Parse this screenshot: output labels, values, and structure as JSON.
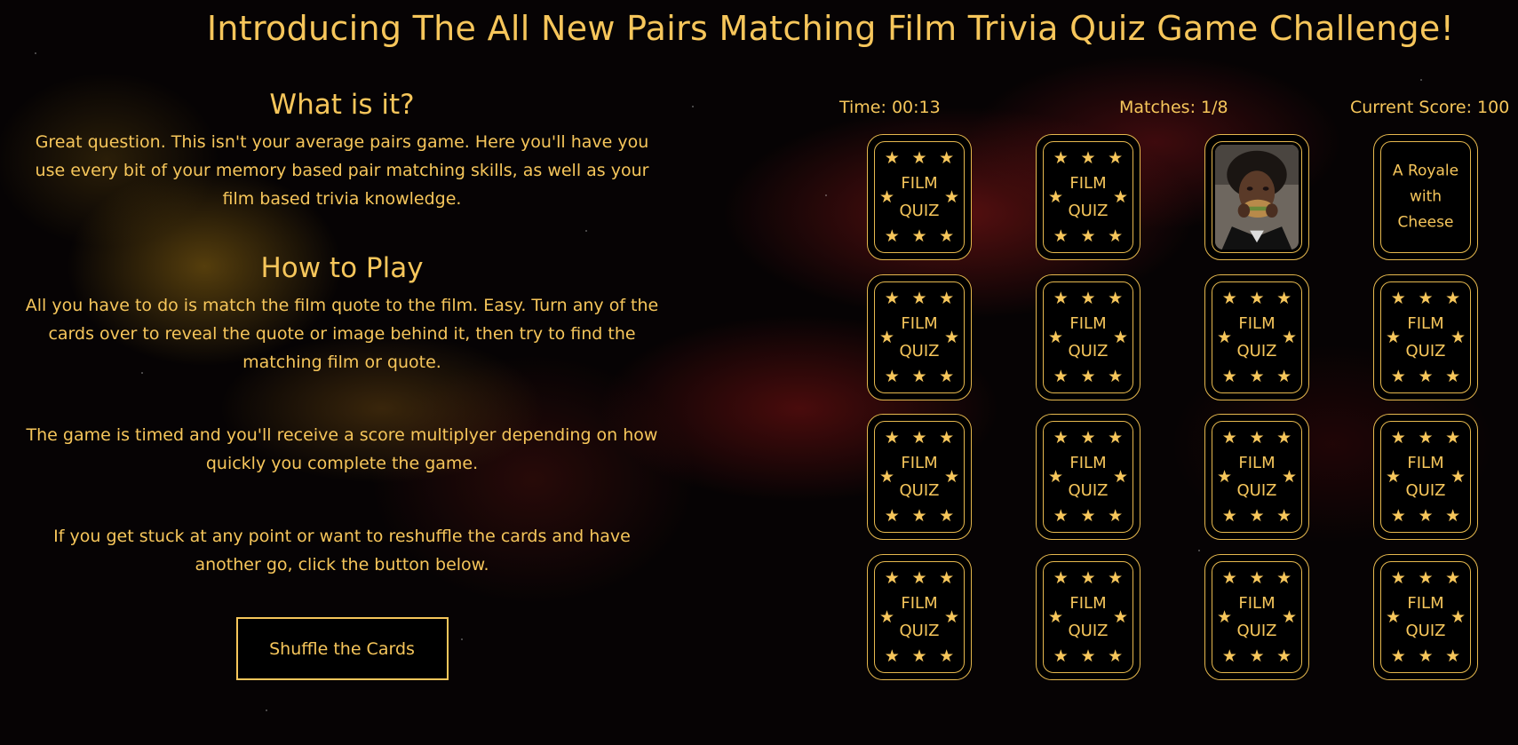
{
  "page": {
    "title": "Introducing The All New Pairs Matching Film Trivia Quiz Game Challenge!"
  },
  "info": {
    "what_heading": "What is it?",
    "what_text": "Great question. This isn't your average pairs game. Here you'll have you use every bit of your memory based pair matching skills, as well as your film based trivia knowledge.",
    "how_heading": "How to Play",
    "how_text_1": "All you have to do is match the film quote to the film. Easy. Turn any of the cards over to reveal the quote or image behind it, then try to find the matching film or quote.",
    "how_text_2": "The game is timed and you'll receive a score multiplyer depending on how quickly you complete the game.",
    "how_text_3": "If you get stuck at any point or want to reshuffle the cards and have another go, click the button below.",
    "shuffle_label": "Shuffle the Cards"
  },
  "stats": {
    "time": "Time: 00:13",
    "matches": "Matches: 1/8",
    "score": "Current Score: 100"
  },
  "card_back": {
    "line1": "FILM",
    "line2": "QUIZ",
    "star": "★"
  },
  "cards": [
    {
      "state": "back"
    },
    {
      "state": "back"
    },
    {
      "state": "image",
      "icon": "film-still-man-eating-burger"
    },
    {
      "state": "quote",
      "text": [
        "A Royale",
        "with",
        "Cheese"
      ]
    },
    {
      "state": "back"
    },
    {
      "state": "back"
    },
    {
      "state": "back"
    },
    {
      "state": "back"
    },
    {
      "state": "back"
    },
    {
      "state": "back"
    },
    {
      "state": "back"
    },
    {
      "state": "back"
    },
    {
      "state": "back"
    },
    {
      "state": "back"
    },
    {
      "state": "back"
    },
    {
      "state": "back"
    }
  ],
  "colors": {
    "accent": "#f6c65b",
    "card_border": "#e6b84e",
    "background": "#060304"
  }
}
